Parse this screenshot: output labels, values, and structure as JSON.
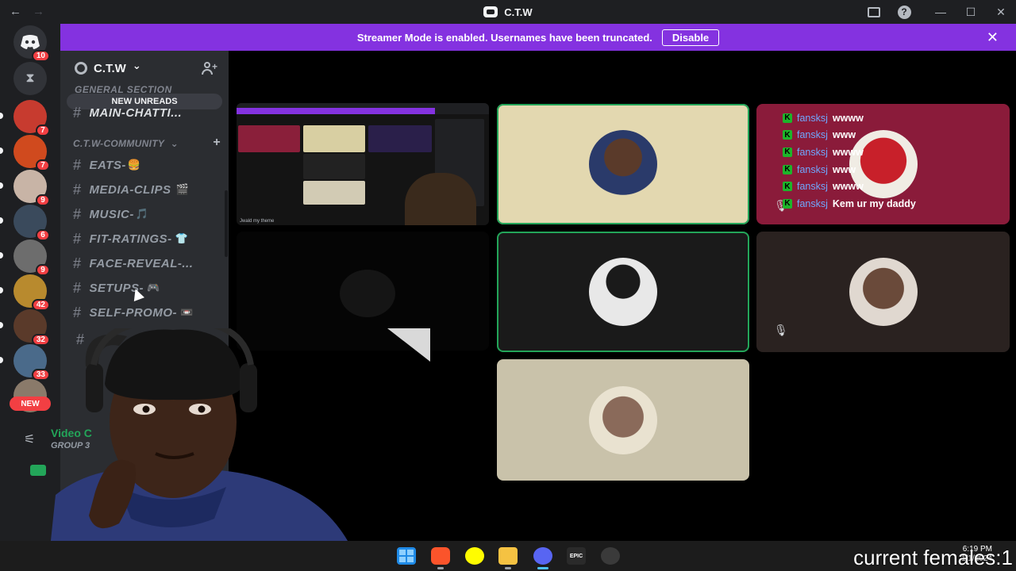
{
  "window": {
    "title": "C.T.W",
    "back_glyph": "←",
    "forward_glyph": "→",
    "minimize_glyph": "—",
    "maximize_glyph": "☐",
    "close_glyph": "✕"
  },
  "banner": {
    "message": "Streamer Mode is enabled. Usernames have been truncated.",
    "button_label": "Disable",
    "close_glyph": "✕",
    "color": "#8432e0"
  },
  "server_rail": {
    "home_badge": "10",
    "servers": [
      {
        "badge": "7",
        "color": "#c73b2f"
      },
      {
        "badge": "7",
        "color": "#d04a1e"
      },
      {
        "badge": "9",
        "color": "#c8b4a6"
      },
      {
        "badge": "6",
        "color": "#3a4a5c"
      },
      {
        "badge": "9",
        "color": "#6d6d6d"
      },
      {
        "badge": "42",
        "color": "#b88a2e"
      },
      {
        "badge": "32",
        "color": "#5a3a2a"
      },
      {
        "badge": "33",
        "color": "#4a6a8a"
      },
      {
        "badge": "",
        "color": "#8a7a6a"
      }
    ],
    "new_label": "NEW"
  },
  "sidebar": {
    "guild_name": "C.T.W",
    "chevron": "⌄",
    "ghost_category": "GENERAL SECTION",
    "new_unreads": "NEW UNREADS",
    "top_channel": "MAIN-CHATTI...",
    "category": "C.T.W-COMMUNITY",
    "category_chevron": "⌄",
    "category_plus": "+",
    "channels": [
      {
        "name": "EATS-",
        "emoji": "🍔"
      },
      {
        "name": "MEDIA-CLIPS",
        "emoji": "🎬"
      },
      {
        "name": "MUSIC-",
        "emoji": "🎵"
      },
      {
        "name": "FIT-RATINGS-",
        "emoji": "👕"
      },
      {
        "name": "FACE-REVEAL-...",
        "emoji": ""
      },
      {
        "name": "SETUPS-",
        "emoji": "🎮"
      },
      {
        "name": "SELF-PROMO-",
        "emoji": "📼"
      }
    ],
    "hash": "#"
  },
  "voice_panel": {
    "title": "Video C",
    "subtitle": "GROUP 3",
    "signal_glyph": "⚟"
  },
  "stage": {
    "share_caption": "Jwald my theme",
    "chat": [
      {
        "user": "fansksj",
        "message": "wwww"
      },
      {
        "user": "fansksj",
        "message": "www"
      },
      {
        "user": "fansksj",
        "message": "wwww"
      },
      {
        "user": "fansksj",
        "message": "www"
      },
      {
        "user": "fansksj",
        "message": "wwww"
      },
      {
        "user": "fansksj",
        "message": "Kem ur my daddy"
      }
    ],
    "k_glyph": "K",
    "mute_glyph": "🎙"
  },
  "taskbar": {
    "clock_time": "6:19 PM",
    "clock_date": "1/1/2024"
  },
  "overlay_caption": "current females:1",
  "colors": {
    "online_green": "#23a559",
    "badge_red": "#f23f43",
    "rail_bg": "#1e1f22",
    "sidebar_bg": "#2b2d31"
  }
}
